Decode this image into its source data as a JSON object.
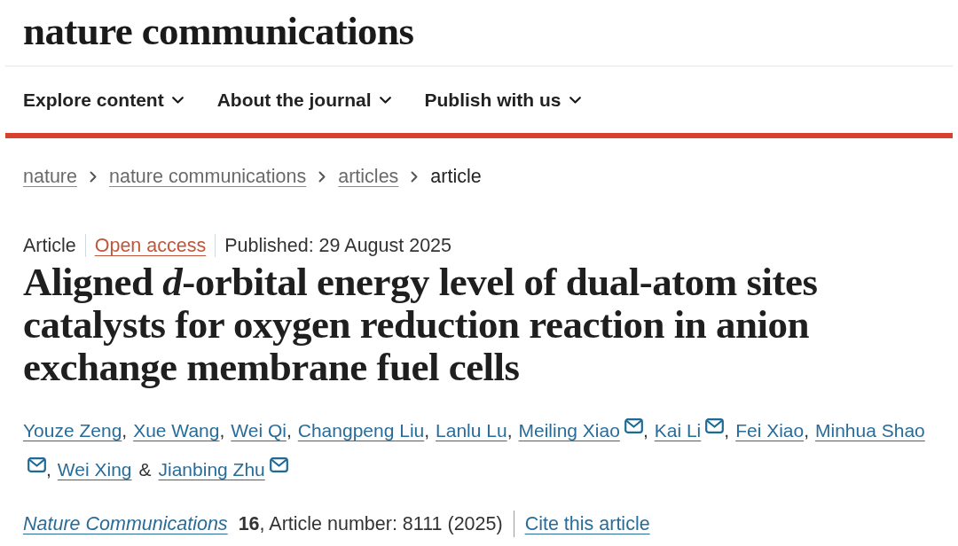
{
  "header": {
    "logo": "nature communications"
  },
  "nav": [
    {
      "label": "Explore content"
    },
    {
      "label": "About the journal"
    },
    {
      "label": "Publish with us"
    }
  ],
  "breadcrumbs": [
    {
      "label": "nature",
      "current": false
    },
    {
      "label": "nature communications",
      "current": false
    },
    {
      "label": "articles",
      "current": false
    },
    {
      "label": "article",
      "current": true
    }
  ],
  "article": {
    "meta": [
      {
        "kind": "type",
        "text": "Article"
      },
      {
        "kind": "access",
        "text": "Open access"
      },
      {
        "kind": "date",
        "text": "Published: 29 August 2025"
      }
    ],
    "title": "Aligned *d*-orbital energy level of dual-atom sites catalysts for oxygen reduction reaction in anion exchange membrane fuel cells",
    "authors": [
      {
        "name": "Youze Zeng",
        "corresponding": false,
        "separator": ","
      },
      {
        "name": "Xue Wang",
        "corresponding": false,
        "separator": ","
      },
      {
        "name": "Wei Qi",
        "corresponding": false,
        "separator": ","
      },
      {
        "name": "Changpeng Liu",
        "corresponding": false,
        "separator": ","
      },
      {
        "name": "Lanlu Lu",
        "corresponding": false,
        "separator": ","
      },
      {
        "name": "Meiling Xiao",
        "corresponding": true,
        "separator": ","
      },
      {
        "name": "Kai Li",
        "corresponding": true,
        "separator": ","
      },
      {
        "name": "Fei Xiao",
        "corresponding": false,
        "separator": ","
      },
      {
        "name": "Minhua Shao",
        "corresponding": true,
        "separator": ","
      },
      {
        "name": "Wei Xing",
        "corresponding": false,
        "separator": "&"
      },
      {
        "name": "Jianbing Zhu",
        "corresponding": true
      }
    ],
    "citation": {
      "journal": "Nature Communications",
      "details": "**16**, Article number: 8111 (2025)"
    },
    "cite_link": "Cite this article"
  }
}
